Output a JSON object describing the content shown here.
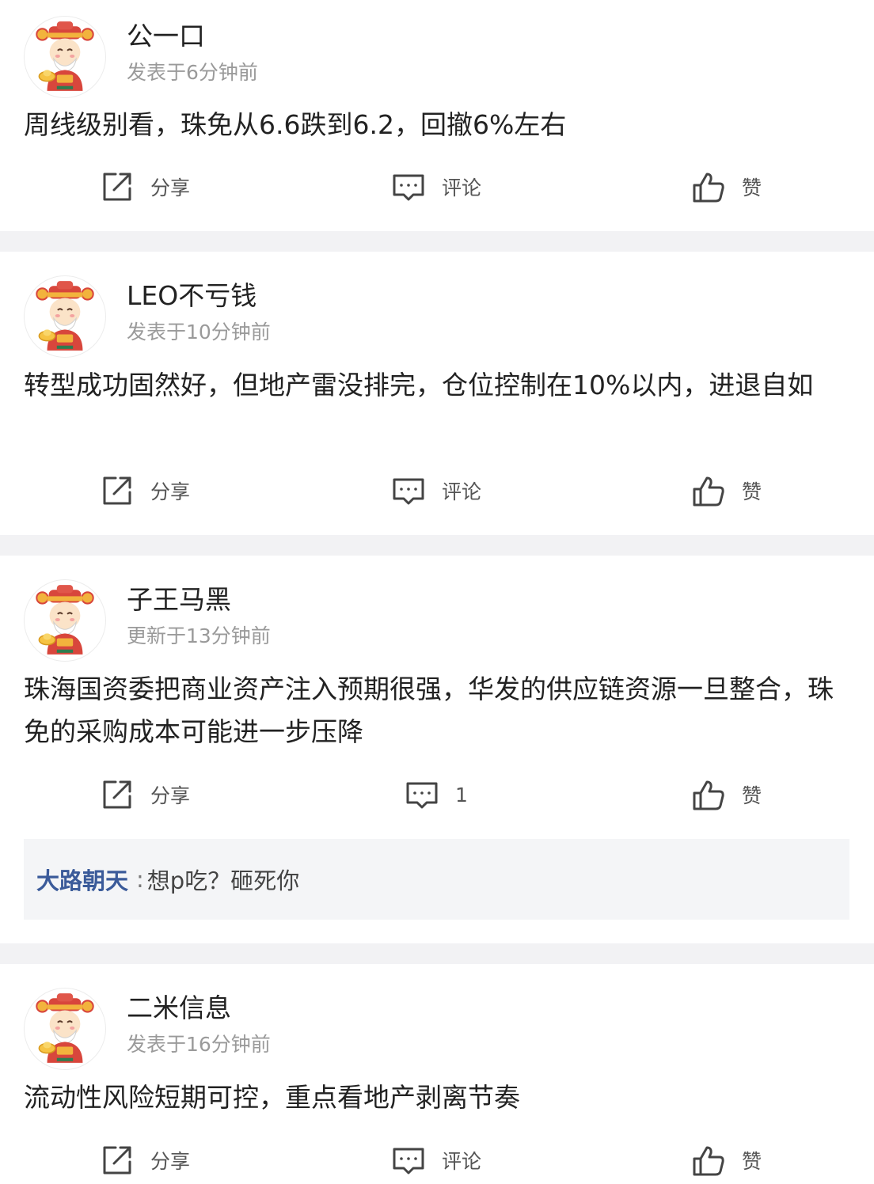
{
  "icons": {
    "share": "share-icon",
    "comment": "comment-icon",
    "like": "thumbs-up-icon",
    "avatar": "caishen-avatar"
  },
  "colors": {
    "divider": "#f2f2f4",
    "reply_author": "#3b5b9a",
    "muted": "#9a9a9a"
  },
  "posts": [
    {
      "username": "公一口",
      "time": "发表于6分钟前",
      "content": "周线级别看，珠免从6.6跌到6.2，回撤6%左右",
      "share_label": "分享",
      "comment_label": "评论",
      "like_label": "赞"
    },
    {
      "username": "LEO不亏钱",
      "time": "发表于10分钟前",
      "content": "转型成功固然好，但地产雷没排完，仓位控制在10%以内，进退自如",
      "share_label": "分享",
      "comment_label": "评论",
      "like_label": "赞"
    },
    {
      "username": "子王马黑",
      "time": "更新于13分钟前",
      "content": "珠海国资委把商业资产注入预期很强，华发的供应链资源一旦整合，珠免的采购成本可能进一步压降",
      "share_label": "分享",
      "comment_label": "1",
      "like_label": "赞",
      "reply": {
        "author": "大路朝天",
        "separator": ":",
        "text": "想p吃？砸死你"
      }
    },
    {
      "username": "二米信息",
      "time": "发表于16分钟前",
      "content": "流动性风险短期可控，重点看地产剥离节奏",
      "share_label": "分享",
      "comment_label": "评论",
      "like_label": "赞"
    }
  ]
}
